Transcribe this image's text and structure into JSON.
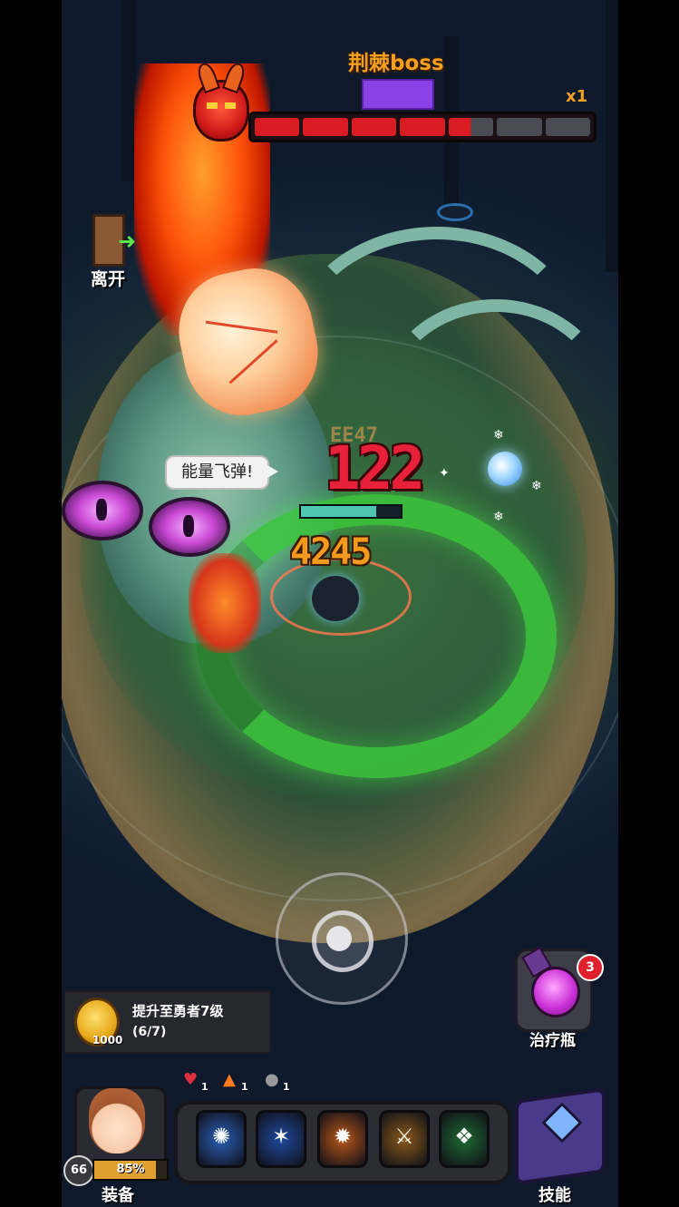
{
  "boss": {
    "name": "荆棘boss",
    "multiplier": "x1",
    "health_segments": 7,
    "health_filled": 4.5,
    "color_health": "#d91c24",
    "color_tag": "#8a41e6"
  },
  "hud": {
    "leave_label": "离开",
    "speech": "能量飞弹!",
    "damage_numbers": [
      "122",
      "4245"
    ]
  },
  "player": {
    "hp_fraction": 0.75
  },
  "quest": {
    "title": "提升至勇者7级",
    "progress": "(6/7)",
    "reward_amount": "1000",
    "reward_icon": "gold-coin-icon"
  },
  "potion": {
    "label": "治疗瓶",
    "count": "3",
    "icon": "healing-potion-icon"
  },
  "buffs": [
    {
      "icon": "heart-buff-icon",
      "count": "1"
    },
    {
      "icon": "fire-buff-icon",
      "count": "1"
    },
    {
      "icon": "bomb-buff-icon",
      "count": "1"
    }
  ],
  "hero": {
    "level": "66",
    "xp_percent": "85%",
    "xp_fraction": 0.85,
    "equip_label": "装备"
  },
  "skills": [
    {
      "name": "blue-vortex-skill-icon",
      "color": "#2a5fb8"
    },
    {
      "name": "ice-burst-skill-icon",
      "color": "#1f4aa0"
    },
    {
      "name": "flame-burst-skill-icon",
      "color": "#b8561a"
    },
    {
      "name": "shadow-strike-skill-icon",
      "color": "#8a5a1a"
    },
    {
      "name": "green-thorn-skill-icon",
      "color": "#1f6a32"
    }
  ],
  "skill_book": {
    "label": "技能",
    "icon": "skill-book-icon"
  }
}
